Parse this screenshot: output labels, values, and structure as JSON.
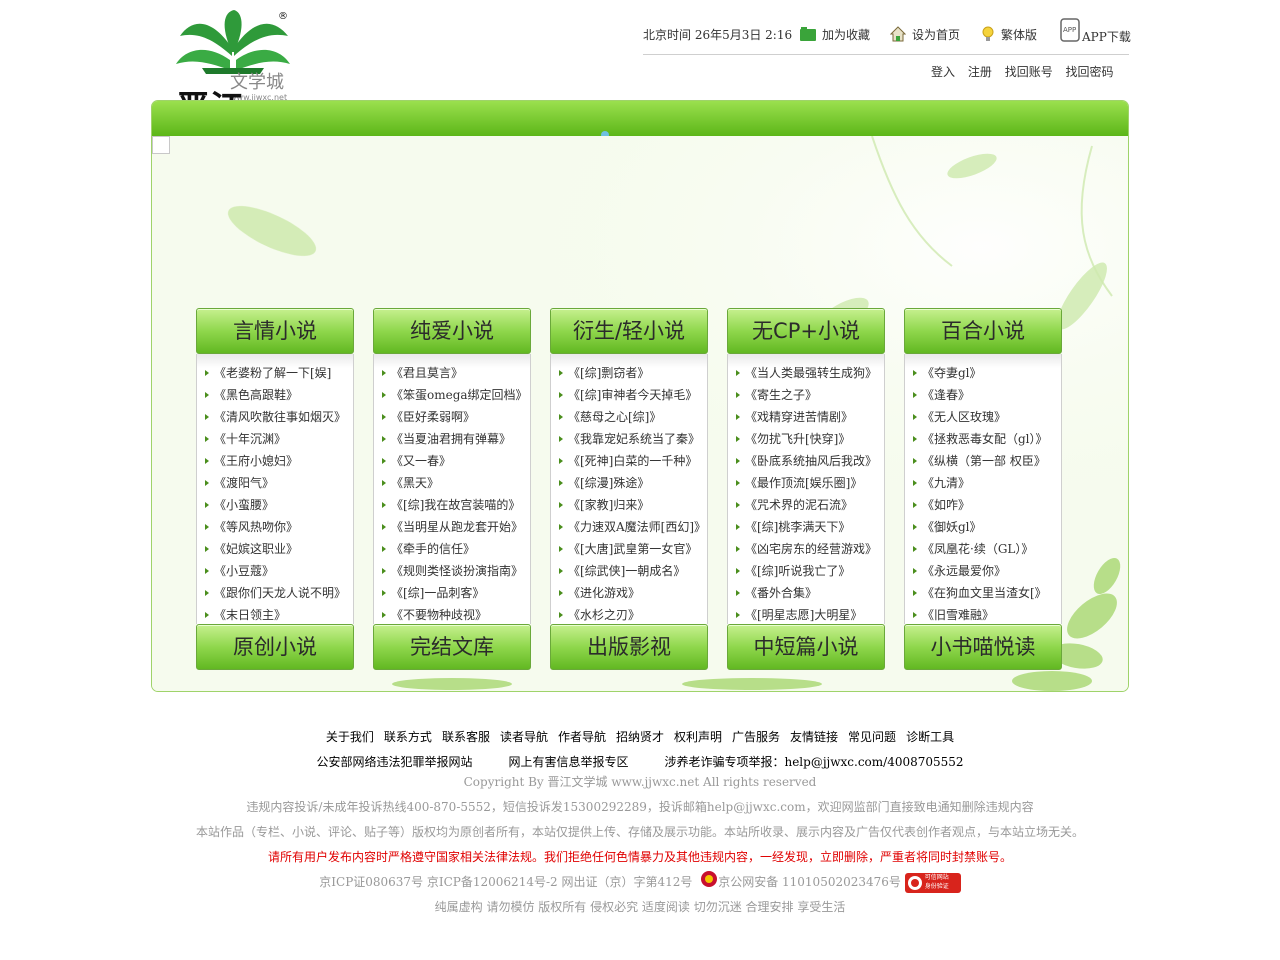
{
  "brand": {
    "logo_text_cn": "文学城",
    "logo_url_text": "www.jjwxc.net",
    "logo_calligraphy": "晋江",
    "registered_mark": "®"
  },
  "topbar": {
    "clock": "北京时间 26年5月3日 2:16",
    "favorite": "加为收藏",
    "homepage": "设为首页",
    "traditional": "繁体版",
    "app": "APP下载"
  },
  "account": {
    "login": "登入",
    "register": "注册",
    "recover_account": "找回账号",
    "recover_password": "找回密码"
  },
  "categories": [
    {
      "title": "言情小说",
      "items": [
        "《老婆粉了解一下[娱]",
        "《黑色高跟鞋》",
        "《清风吹散往事如烟灭》",
        "《十年沉渊》",
        "《王府小媳妇》",
        "《渡阳气》",
        "《小蛮腰》",
        "《等风热吻你》",
        "《妃嫔这职业》",
        "《小豆蔻》",
        "《跟你们天龙人说不明》",
        "《末日领主》"
      ]
    },
    {
      "title": "纯爱小说",
      "items": [
        "《君且莫言》",
        "《笨蛋omega绑定回档》",
        "《臣好柔弱啊》",
        "《当夏油君拥有弹幕》",
        "《又一春》",
        "《黑天》",
        "《[综]我在故宫装喵的》",
        "《当明星从跑龙套开始》",
        "《牵手的信任》",
        "《规则类怪谈扮演指南》",
        "《[综]一品刺客》",
        "《不要物种歧视》"
      ]
    },
    {
      "title": "衍生/轻小说",
      "items": [
        "《[综]剽窃者》",
        "《[综]审神者今天掉毛》",
        "《慈母之心[综]》",
        "《我靠宠妃系统当了秦》",
        "《[死神]白菜的一千种》",
        "《[综漫]殊途》",
        "《[家教]归来》",
        "《力速双A魔法师[西幻]》",
        "《[大唐]武皇第一女官》",
        "《[综武侠]一朝成名》",
        "《进化游戏》",
        "《水杉之刃》"
      ]
    },
    {
      "title": "无CP+小说",
      "items": [
        "《当人类最强转生成狗》",
        "《寄生之子》",
        "《戏精穿进苦情剧》",
        "《勿扰飞升[快穿]》",
        "《卧底系统抽风后我改》",
        "《最作顶流[娱乐圈]》",
        "《咒术界的泥石流》",
        "《[综]桃李满天下》",
        "《凶宅房东的经营游戏》",
        "《[综]听说我亡了》",
        "《番外合集》",
        "《[明星志愿]大明星》"
      ]
    },
    {
      "title": "百合小说",
      "items": [
        "《夺妻gl》",
        "《逢春》",
        "《无人区玫瑰》",
        "《拯救恶毒女配（gl）》",
        "《纵横（第一部 权臣》",
        "《九清》",
        "《如咋》",
        "《御妖gl》",
        "《凤凰花·续（GL）》",
        "《永远最爱你》",
        "《在狗血文里当渣女[》",
        "《旧雪难融》"
      ]
    }
  ],
  "bottom_categories": [
    "原创小说",
    "完结文库",
    "出版影视",
    "中短篇小说",
    "小书喵悦读"
  ],
  "footer": {
    "links": [
      "关于我们",
      "联系方式",
      "联系客服",
      "读者导航",
      "作者导航",
      "招纳贤才",
      "权利声明",
      "广告服务",
      "友情链接",
      "常见问题",
      "诊断工具"
    ],
    "report_links": [
      "公安部网络违法犯罪举报网站",
      "网上有害信息举报专区",
      "涉养老诈骗专项举报：help@jjwxc.com/4008705552"
    ],
    "copyright": "Copyright By 晋江文学城 www.jjwxc.net All rights reserved",
    "complaint": "违规内容投诉/未成年投诉热线400-870-5552，短信投诉发15300292289，投诉邮箱help@jjwxc.com，欢迎网监部门直接致电通知删除违规内容",
    "statement": "本站作品（专栏、小说、评论、贴子等）版权均为原创者所有，本站仅提供上传、存储及展示功能。本站所收录、展示内容及广告仅代表创作者观点，与本站立场无关。",
    "warning": "请所有用户发布内容时严格遵守国家相关法律法规。我们拒绝任何色情暴力及其他违规内容，一经发现，立即删除，严重者将同时封禁账号。",
    "icp": "京ICP证080637号  京ICP备12006214号-2  网出证（京）字第412号",
    "police": "京公网安备 11010502023476号",
    "badge_line1": "可信网站",
    "badge_line2": "身份验证",
    "slogan": "纯属虚构 请勿模仿 版权所有 侵权必究 适度阅读 切勿沉迷 合理安排 享受生活"
  },
  "colors": {
    "accent_green": "#5cb618",
    "header_green": "#8fd74c",
    "warning_red": "#e00000",
    "muted_gray": "#999999"
  }
}
